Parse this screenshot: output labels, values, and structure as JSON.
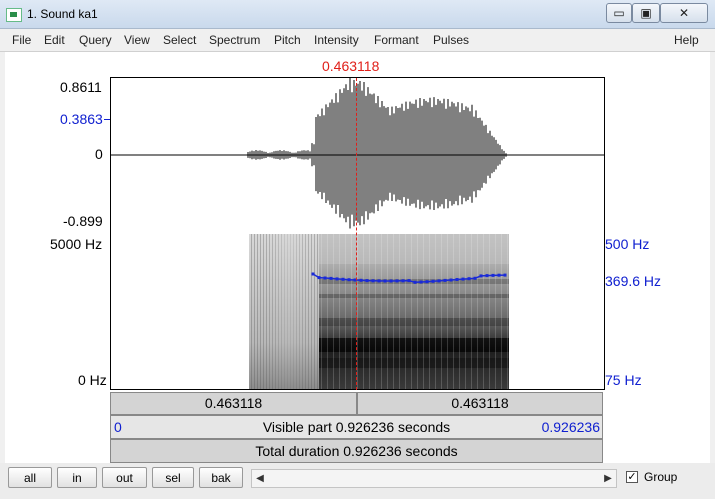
{
  "window": {
    "title": "1. Sound ka1",
    "minimize_glyph": "▭",
    "maximize_glyph": "▣",
    "close_glyph": "✕"
  },
  "menu": [
    "File",
    "Edit",
    "Query",
    "View",
    "Select",
    "Spectrum",
    "Pitch",
    "Intensity",
    "Formant",
    "Pulses",
    "Help"
  ],
  "editor": {
    "cursor_time": "0.463118",
    "waveform": {
      "max_label": "0.8611",
      "cursor_value": "0.3863",
      "zero_label": "0",
      "min_label": "-0.899"
    },
    "spectrogram": {
      "top_freq_label": "5000 Hz",
      "bottom_freq_label": "0 Hz",
      "pitch_top_label": "500 Hz",
      "pitch_value_label": "369.6 Hz",
      "pitch_bottom_label": "75 Hz"
    },
    "selection_left": "0.463118",
    "selection_right": "0.463118",
    "visible_start": "0",
    "visible_part": "Visible part 0.926236 seconds",
    "visible_end": "0.926236",
    "total_duration": "Total duration 0.926236 seconds"
  },
  "controls": {
    "buttons": [
      "all",
      "in",
      "out",
      "sel",
      "bak"
    ],
    "scroll_left": "◀",
    "scroll_right": "▶",
    "group_checked": true,
    "check_glyph": "✓",
    "group_label": "Group"
  },
  "colors": {
    "cursor": "#e0201a",
    "pitch": "#1a2ad8",
    "label_blue": "#1020d0"
  }
}
